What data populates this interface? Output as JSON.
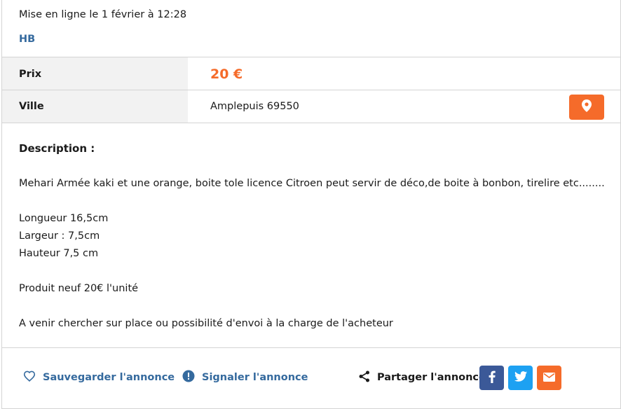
{
  "listing": {
    "posted": "Mise en ligne le 1 février à 12:28",
    "seller": "HB"
  },
  "details": {
    "price_label": "Prix",
    "price_value": "20 €",
    "city_label": "Ville",
    "city_value": "Amplepuis 69550"
  },
  "description": {
    "title": "Description :",
    "lines": [
      "Mehari Armée kaki et une orange, boite tole licence Citroen peut servir de déco,de boite à bonbon, tirelire etc........",
      "",
      "Longueur 16,5cm",
      "Largeur : 7,5cm",
      "Hauteur 7,5 cm",
      "",
      "Produit neuf 20€ l'unité",
      "",
      "A venir chercher sur place ou possibilité d'envoi à la charge de l'acheteur"
    ]
  },
  "actions": {
    "save_label": "Sauvegarder l'annonce",
    "report_label": "Signaler l'annonce",
    "share_label": "Partager l'annonce"
  },
  "icons": {
    "map": "map-pin-icon",
    "save": "heart-icon",
    "report": "alert-icon",
    "share": "share-icon",
    "facebook": "facebook-icon",
    "twitter": "twitter-icon",
    "email": "mail-icon"
  },
  "colors": {
    "accent": "#f56b2a",
    "link": "#356a9e",
    "facebook": "#3b5998",
    "twitter": "#1da1f2"
  }
}
